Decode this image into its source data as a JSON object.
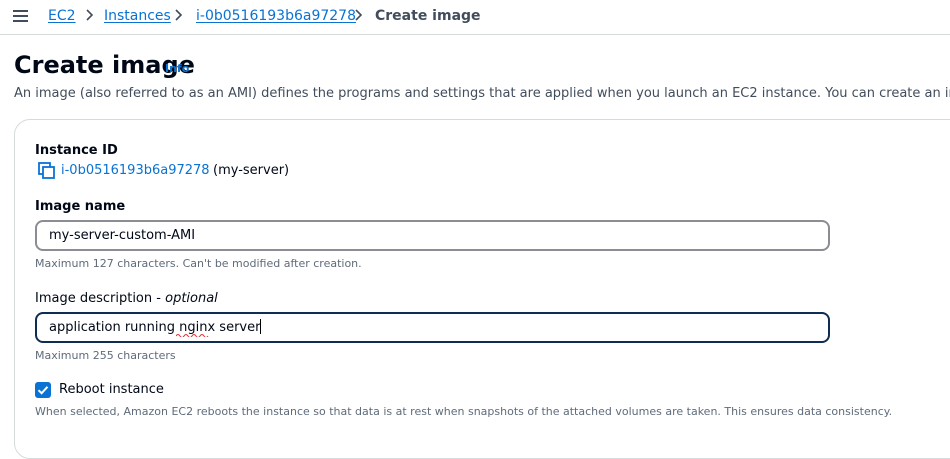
{
  "breadcrumbs": [
    {
      "label": "EC2"
    },
    {
      "label": "Instances"
    },
    {
      "label": "i-0b0516193b6a97278"
    },
    {
      "label": "Create image"
    }
  ],
  "header": {
    "title": "Create image",
    "info": "Info",
    "description": "An image (also referred to as an AMI) defines the programs and settings that are applied when you launch an EC2 instance. You can create an image"
  },
  "form": {
    "instance_id": {
      "label": "Instance ID",
      "value": "i-0b0516193b6a97278",
      "name": "(my-server)"
    },
    "image_name": {
      "label": "Image name",
      "value": "my-server-custom-AMI",
      "hint": "Maximum 127 characters. Can't be modified after creation."
    },
    "image_description": {
      "label": "Image description",
      "optional": "optional",
      "value": "application running nginx server",
      "hint": "Maximum 255 characters"
    },
    "reboot": {
      "label": "Reboot instance",
      "checked": true,
      "hint": "When selected, Amazon EC2 reboots the instance so that data is at rest when snapshots of the attached volumes are taken. This ensures data consistency."
    }
  },
  "colors": {
    "link": "#0972d3",
    "text": "#000716",
    "secondary_text": "#414d5c",
    "hint_text": "#5f6b7a",
    "border": "#d5dbdb",
    "focus_border": "#0f2d52"
  },
  "icons": {
    "menu": "hamburger-icon",
    "separator": "chevron-right-icon",
    "copy": "copy-icon",
    "check": "checkmark-icon"
  }
}
